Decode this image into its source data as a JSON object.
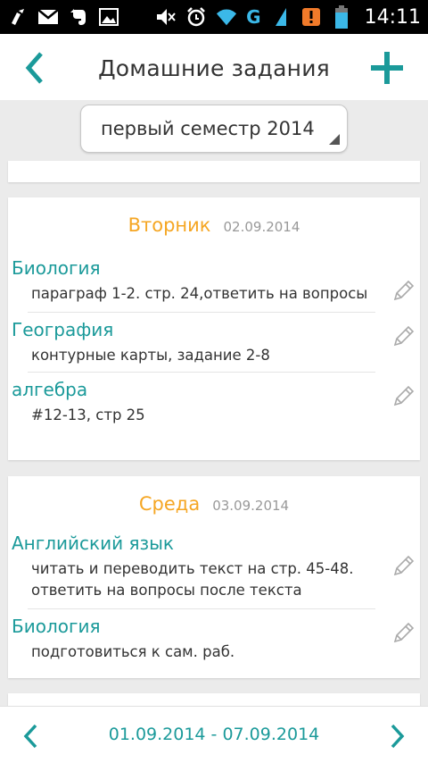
{
  "status_bar": {
    "time": "14:11",
    "network": "G",
    "icons": [
      "cleaner-icon",
      "gmail-icon",
      "evernote-icon",
      "gallery-icon",
      "mute-icon",
      "alarm-icon",
      "wifi-icon",
      "signal-icon",
      "notification-badge-icon",
      "battery-icon"
    ]
  },
  "app_bar": {
    "title": "Домашние задания",
    "back_icon": "chevron-left-icon",
    "add_icon": "plus-icon"
  },
  "semester_select": {
    "selected": "первый семестр 2014"
  },
  "days": [
    {
      "name": "Вторник",
      "date": "02.09.2014",
      "entries": [
        {
          "subject": "Биология",
          "task": "параграф 1-2. стр. 24,ответить на вопросы"
        },
        {
          "subject": "География",
          "task": "контурные карты, задание 2-8"
        },
        {
          "subject": "алгебра",
          "task": "#12-13, стр 25"
        }
      ]
    },
    {
      "name": "Среда",
      "date": "03.09.2014",
      "entries": [
        {
          "subject": "Английский язык",
          "task": "читать и переводить текст на стр. 45-48. ответить на вопросы после текста"
        },
        {
          "subject": "Биология",
          "task": "подготовиться к сам. раб."
        }
      ]
    }
  ],
  "bottom_nav": {
    "week_range": "01.09.2014 - 07.09.2014"
  },
  "colors": {
    "accent": "#1b9a9a",
    "day_name": "#f5a623",
    "background": "#ebebeb"
  }
}
